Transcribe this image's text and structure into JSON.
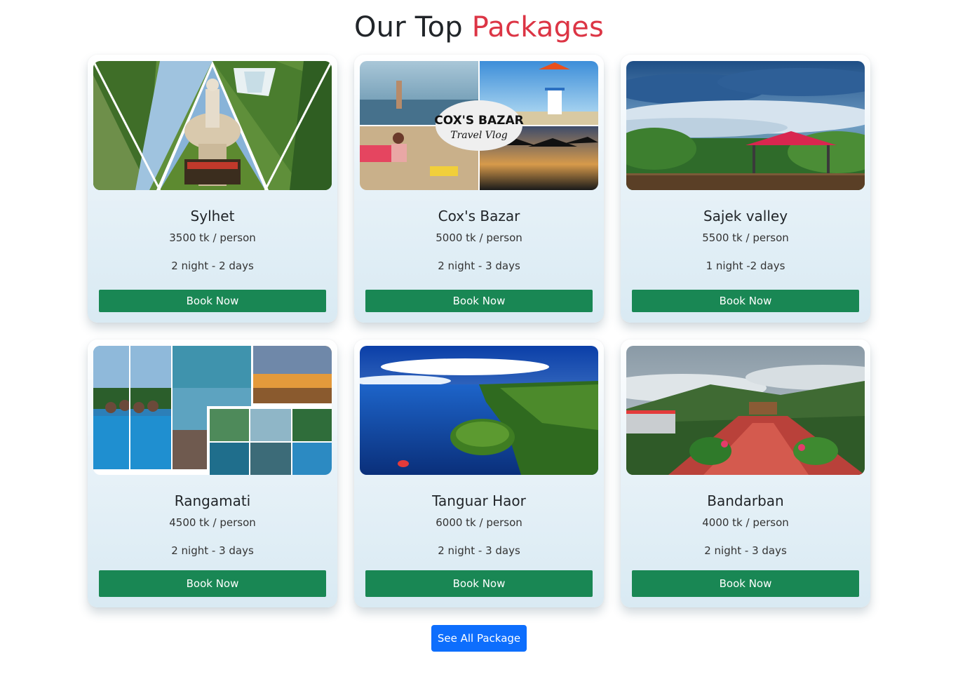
{
  "heading": {
    "part1": "Our Top ",
    "part2": "Packages"
  },
  "colors": {
    "accent_red": "#dc3545",
    "book_green": "#198754",
    "see_all_blue": "#0d6efd"
  },
  "packages": [
    {
      "name": "Sylhet",
      "price": "3500 tk / person",
      "duration": "2 night - 2 days",
      "button": "Book Now",
      "image": "sylhet-collage-photo"
    },
    {
      "name": "Cox's Bazar",
      "price": "5000 tk / person",
      "duration": "2 night - 3 days",
      "button": "Book Now",
      "image": "coxs-bazar-collage-photo",
      "image_text": [
        "COX'S BAZAR",
        "Travel Vlog"
      ]
    },
    {
      "name": "Sajek valley",
      "price": "5500 tk / person",
      "duration": "1 night -2 days",
      "button": "Book Now",
      "image": "sajek-valley-photo"
    },
    {
      "name": "Rangamati",
      "price": "4500 tk / person",
      "duration": "2 night - 3 days",
      "button": "Book Now",
      "image": "rangamati-collage-photo"
    },
    {
      "name": "Tanguar Haor",
      "price": "6000 tk / person",
      "duration": "2 night - 3 days",
      "button": "Book Now",
      "image": "tanguar-haor-photo"
    },
    {
      "name": "Bandarban",
      "price": "4000 tk / person",
      "duration": "2 night - 3 days",
      "button": "Book Now",
      "image": "bandarban-photo"
    }
  ],
  "see_all": "See All Package"
}
